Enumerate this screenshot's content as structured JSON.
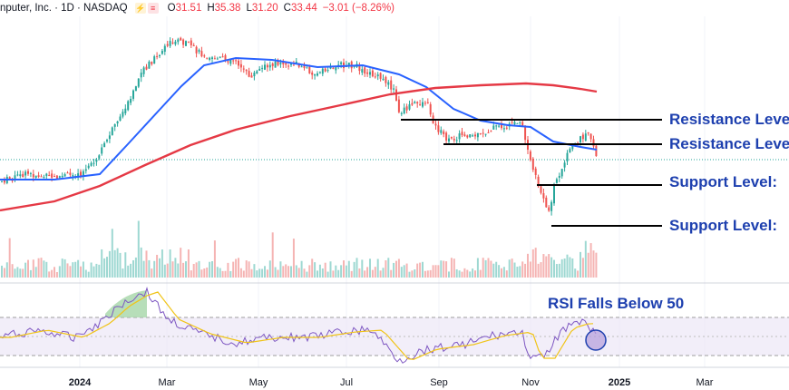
{
  "header": {
    "symbol": "nputer, Inc. · 1D · NASDAQ",
    "o_label": "O",
    "o_value": "31.51",
    "h_label": "H",
    "h_value": "35.38",
    "l_label": "L",
    "l_value": "31.20",
    "c_label": "C",
    "c_value": "33.44",
    "change": "−3.01 (−8.26%)"
  },
  "annotations": {
    "resistance_1": "Resistance Level",
    "resistance_2": "Resistance Level",
    "support_1": "Support Level:",
    "support_2": "Support Level:",
    "rsi_note": "RSI Falls Below 50"
  },
  "colors": {
    "up": "#26a69a",
    "down": "#ef5350",
    "sma_short": "#2962ff",
    "sma_long": "#e53945",
    "rsi": "#7e57c2",
    "rsi_ma": "#f0c419",
    "annotation": "#1e40af",
    "level_line": "#000000"
  },
  "chart_data": {
    "type": "candlestick",
    "x_axis": {
      "ticks": [
        "2024",
        "Mar",
        "May",
        "Jul",
        "Sep",
        "Nov",
        "2025",
        "Mar"
      ],
      "bold_ticks": [
        "2024",
        "2025"
      ]
    },
    "price": {
      "last_close": 33.44,
      "resistance_levels": [
        "Resistance Level",
        "Resistance Level"
      ],
      "support_levels": [
        "Support Level:",
        "Support Level:"
      ]
    },
    "indicators": [
      "50-day moving average",
      "200-day moving average",
      "Volume",
      "RSI"
    ],
    "rsi": {
      "upper_band": 70,
      "lower_band": 30,
      "note": "RSI Falls Below 50"
    }
  }
}
